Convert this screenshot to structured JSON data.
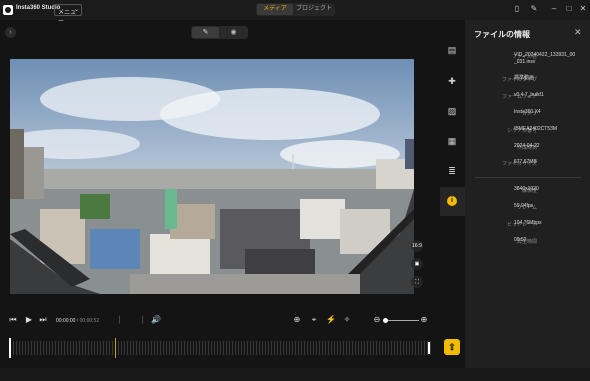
{
  "titlebar": {
    "app_name": "Insta360 Studio",
    "menu_label": "メニュー",
    "tabs": [
      {
        "label": "メディア",
        "active": true
      },
      {
        "label": "プロジェクト",
        "active": false
      }
    ]
  },
  "view_toggle": {
    "options": [
      "edit-icon",
      "eye-icon"
    ],
    "active": "edit-icon"
  },
  "info_panel": {
    "title": "ファイルの情報",
    "rows": [
      {
        "label": "ファイル名",
        "value": "VID_20240422_133931_00_031.insv"
      },
      {
        "label": "ファイルタイプ",
        "value": "標準動画"
      },
      {
        "label": "ファームウェア",
        "value": "v0.4.7_build1"
      },
      {
        "label": "カメラ",
        "value": "Insta360 X4"
      },
      {
        "label": "シリアル番号",
        "value": "IBMEA2402CT53M"
      },
      {
        "label": "作成時刻",
        "value": "2024-04-22"
      },
      {
        "label": "ファイルサイズ",
        "value": "677.67MB"
      }
    ],
    "video_rows": [
      {
        "label": "解像度",
        "value": "3840x1920"
      },
      {
        "label": "フレーム",
        "value": "59.94fps"
      },
      {
        "label": "ビットレート",
        "value": "104.76Mbps"
      },
      {
        "label": "再生時間",
        "value": "00:52"
      }
    ]
  },
  "video_overlay": {
    "ratio_label": "16:9"
  },
  "player": {
    "current_time": "00:00:00",
    "total_time": "00:00:52",
    "zoom_level": 0.0
  },
  "colors": {
    "accent": "#f2bd00",
    "background": "#141414",
    "panel": "#202020"
  }
}
